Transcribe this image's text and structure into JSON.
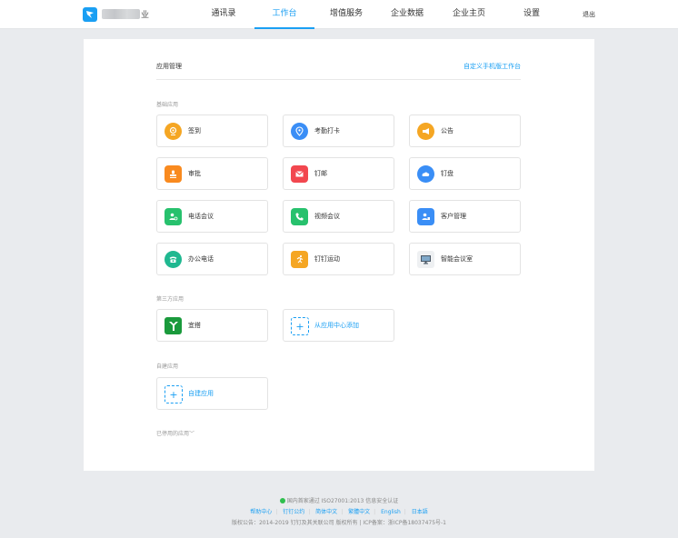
{
  "header": {
    "company_suffix": "业",
    "tabs": [
      "通讯录",
      "工作台",
      "增值服务",
      "企业数据",
      "企业主页",
      "设置"
    ],
    "active_tab_index": 1,
    "logout_label": "退出"
  },
  "main": {
    "title": "应用管理",
    "customize_link": "自定义手机版工作台",
    "basic_section": {
      "label": "基础应用",
      "apps": [
        {
          "name": "签到",
          "icon": "location-pin-icon",
          "color": "#f5a623"
        },
        {
          "name": "考勤打卡",
          "icon": "location-marker-icon",
          "color": "#3a8ef6"
        },
        {
          "name": "公告",
          "icon": "megaphone-icon",
          "color": "#f5a623"
        },
        {
          "name": "审批",
          "icon": "stamp-icon",
          "color": "#f98a1f"
        },
        {
          "name": "钉邮",
          "icon": "mail-icon",
          "color": "#f2474f"
        },
        {
          "name": "钉盘",
          "icon": "cloud-icon",
          "color": "#3a8ef6"
        },
        {
          "name": "电话会议",
          "icon": "conference-call-icon",
          "color": "#27c16d"
        },
        {
          "name": "视频会议",
          "icon": "video-call-icon",
          "color": "#27c16d"
        },
        {
          "name": "客户管理",
          "icon": "customer-icon",
          "color": "#3a8ef6"
        },
        {
          "name": "办公电话",
          "icon": "telephone-icon",
          "color": "#1fb890"
        },
        {
          "name": "钉钉运动",
          "icon": "running-icon",
          "color": "#f5a623"
        },
        {
          "name": "智能会议室",
          "icon": "monitor-icon",
          "color": "#5b6b7c"
        }
      ]
    },
    "third_party_section": {
      "label": "第三方应用",
      "apps": [
        {
          "name": "宜搭",
          "icon": "yida-logo-icon",
          "color": "#1a9a3c"
        }
      ],
      "add_label": "从应用中心添加"
    },
    "custom_section": {
      "label": "自建应用",
      "add_label": "自建应用"
    },
    "disabled_toggle": "已停用的应用"
  },
  "footer": {
    "certification": "国内首家通过 ISO27001:2013 信息安全认证",
    "links": [
      "帮助中心",
      "钉钉公约",
      "简体中文",
      "繁體中文",
      "English",
      "日本語"
    ],
    "copyright": "版权公告：2014-2019 钉钉及其关联公司 版权所有 | ICP备案：浙ICP备18037475号-1"
  }
}
